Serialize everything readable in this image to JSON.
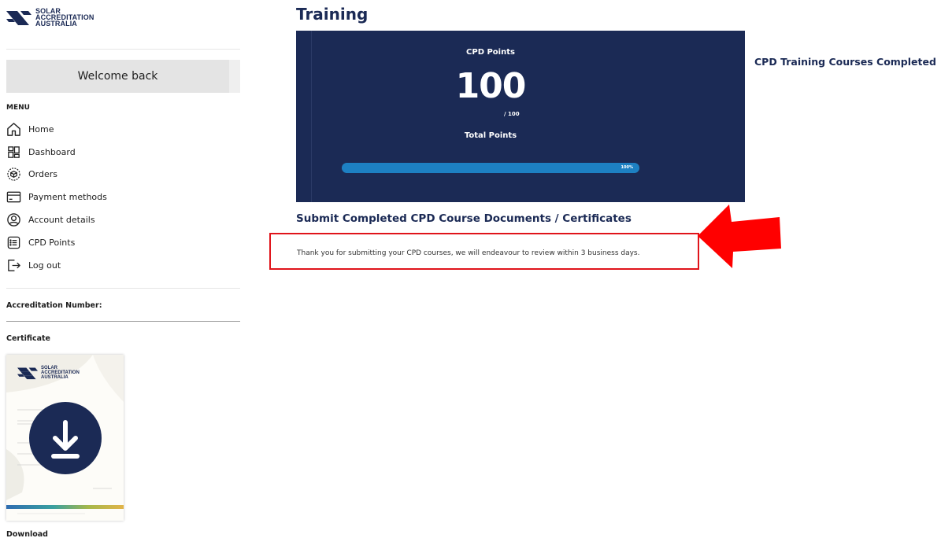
{
  "sidebar": {
    "logo_text": [
      "SOLAR",
      "ACCREDITATION",
      "AUSTRALIA"
    ],
    "welcome": "Welcome back",
    "menu_title": "MENU",
    "menu_items": [
      {
        "label": "Home",
        "icon": "home-icon"
      },
      {
        "label": "Dashboard",
        "icon": "dashboard-icon"
      },
      {
        "label": "Orders",
        "icon": "orders-icon"
      },
      {
        "label": "Payment methods",
        "icon": "credit-card-icon"
      },
      {
        "label": "Account details",
        "icon": "user-icon"
      },
      {
        "label": "CPD Points",
        "icon": "list-icon"
      },
      {
        "label": "Log out",
        "icon": "logout-icon"
      }
    ],
    "accreditation_label": "Accreditation Number:",
    "certificate_label": "Certificate",
    "download_label": "Download"
  },
  "main": {
    "title": "Training",
    "cpd": {
      "label": "CPD Points",
      "points": "100",
      "of_total": "/ 100",
      "total_label": "Total Points",
      "progress_percent": 100,
      "progress_text": "100%"
    },
    "side_heading": "CPD Training Courses Completed",
    "submit_heading": "Submit Completed CPD Course Documents / Certificates",
    "submission_message": "Thank you for submitting your CPD courses, we will endeavour  to review within 3 business days."
  },
  "colors": {
    "brand_navy": "#1b2a55",
    "progress": "#1d80c3",
    "highlight_red": "#e0141b"
  }
}
